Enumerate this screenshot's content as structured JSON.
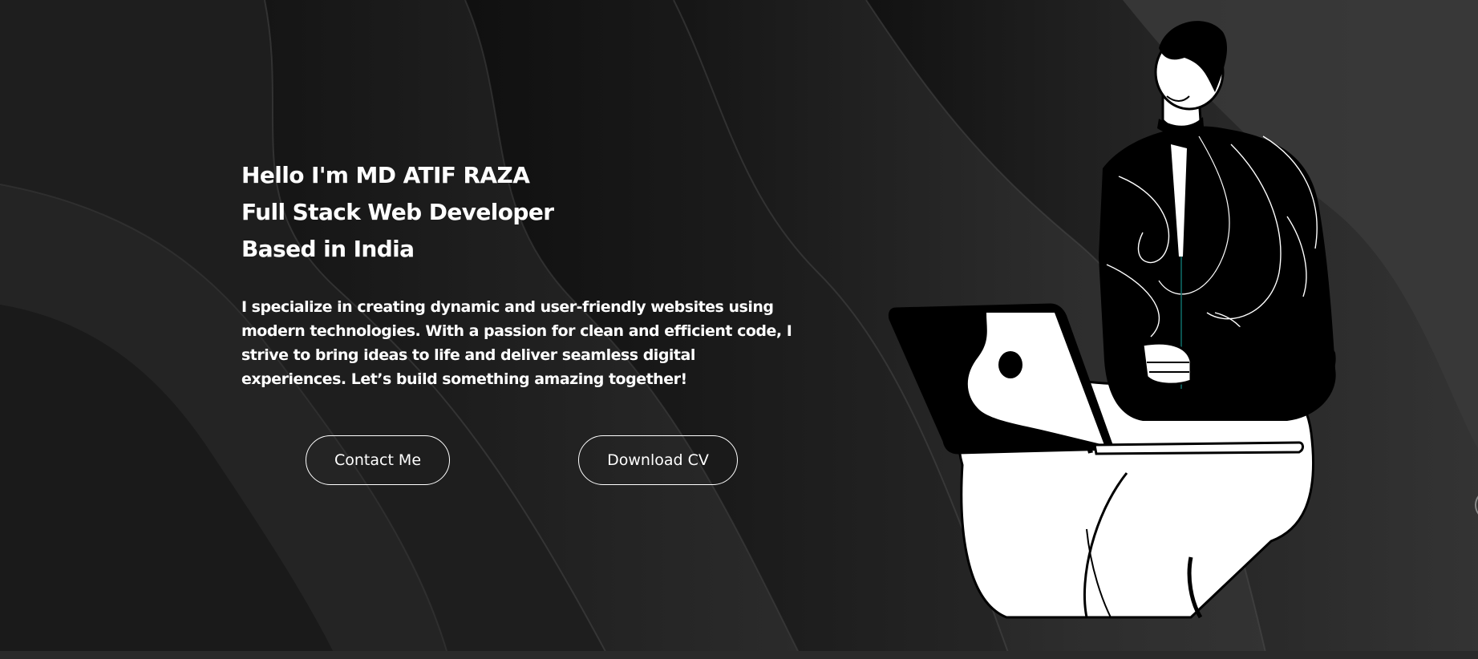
{
  "hero": {
    "headline": [
      "Hello I'm MD ATIF RAZA",
      "Full Stack Web Developer",
      "Based in India"
    ],
    "intro": "I specialize in creating dynamic and user-friendly websites using modern technologies. With a passion for clean and efficient code, I strive to bring ideas to life and deliver seamless digital experiences. Let’s build something amazing together!"
  },
  "buttons": {
    "contact_label": "Contact Me",
    "cv_label": "Download CV"
  },
  "icons": {
    "hero_illustration": "person-with-laptop-icon"
  },
  "colors": {
    "background": "#222222",
    "text": "#ffffff",
    "button_border": "#ffffff"
  }
}
